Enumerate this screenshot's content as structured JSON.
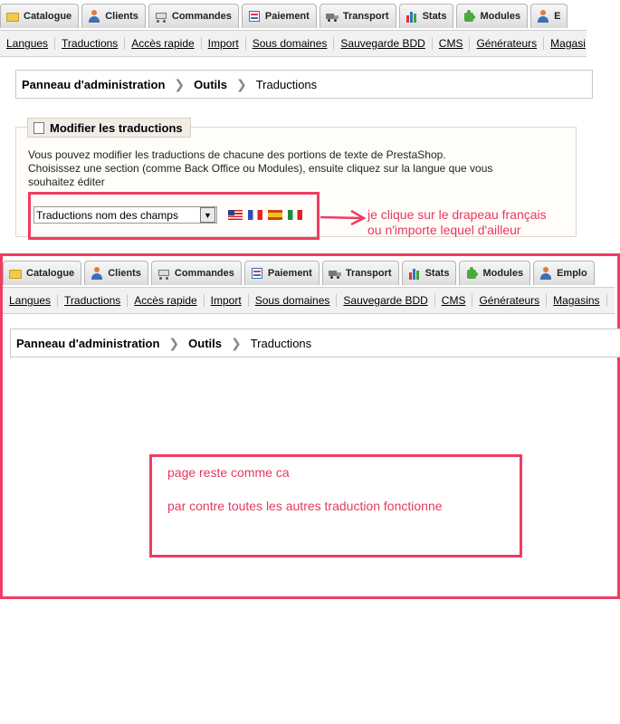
{
  "top": {
    "tabs": [
      {
        "label": "Catalogue",
        "icon": "folder-icon"
      },
      {
        "label": "Clients",
        "icon": "user-icon"
      },
      {
        "label": "Commandes",
        "icon": "cart-icon"
      },
      {
        "label": "Paiement",
        "icon": "payment-icon"
      },
      {
        "label": "Transport",
        "icon": "truck-icon"
      },
      {
        "label": "Stats",
        "icon": "bar-chart-icon"
      },
      {
        "label": "Modules",
        "icon": "puzzle-icon"
      },
      {
        "label": "E",
        "icon": "user-icon"
      }
    ],
    "subnav": [
      "Langues",
      "Traductions",
      "Accès rapide",
      "Import",
      "Sous domaines",
      "Sauvegarde BDD",
      "CMS",
      "Générateurs",
      "Magasi"
    ],
    "breadcrumb": {
      "root": "Panneau d'administration",
      "section": "Outils",
      "current": "Traductions"
    },
    "panel": {
      "legend": "Modifier les traductions",
      "desc_line1": "Vous pouvez modifier les traductions de chacune des portions de texte de PrestaShop.",
      "desc_line2": "Choisissez une section (comme Back Office ou Modules), ensuite cliquez sur la langue que vous",
      "desc_line3": "souhaitez éditer",
      "select_value": "Traductions nom des champs",
      "flags": [
        "us-flag-icon",
        "fr-flag-icon",
        "es-flag-icon",
        "it-flag-icon"
      ]
    },
    "annotation_line1": "je clique sur le drapeau français",
    "annotation_line2": "ou n'importe lequel d'ailleur"
  },
  "bottom": {
    "tabs": [
      {
        "label": "Catalogue",
        "icon": "folder-icon"
      },
      {
        "label": "Clients",
        "icon": "user-icon"
      },
      {
        "label": "Commandes",
        "icon": "cart-icon"
      },
      {
        "label": "Paiement",
        "icon": "payment-icon"
      },
      {
        "label": "Transport",
        "icon": "truck-icon"
      },
      {
        "label": "Stats",
        "icon": "bar-chart-icon"
      },
      {
        "label": "Modules",
        "icon": "puzzle-icon"
      },
      {
        "label": "Emplo",
        "icon": "user-icon"
      }
    ],
    "subnav": [
      "Langues",
      "Traductions",
      "Accès rapide",
      "Import",
      "Sous domaines",
      "Sauvegarde BDD",
      "CMS",
      "Générateurs",
      "Magasins"
    ],
    "breadcrumb": {
      "root": "Panneau d'administration",
      "section": "Outils",
      "current": "Traductions"
    },
    "note_line1": "page reste comme ca",
    "note_line2": "par contre toutes les autres traduction fonctionne"
  },
  "colors": {
    "annotation": "#ef3c63",
    "tab_bg": "#e3e3e3",
    "panel_border": "#e3d6c6"
  }
}
